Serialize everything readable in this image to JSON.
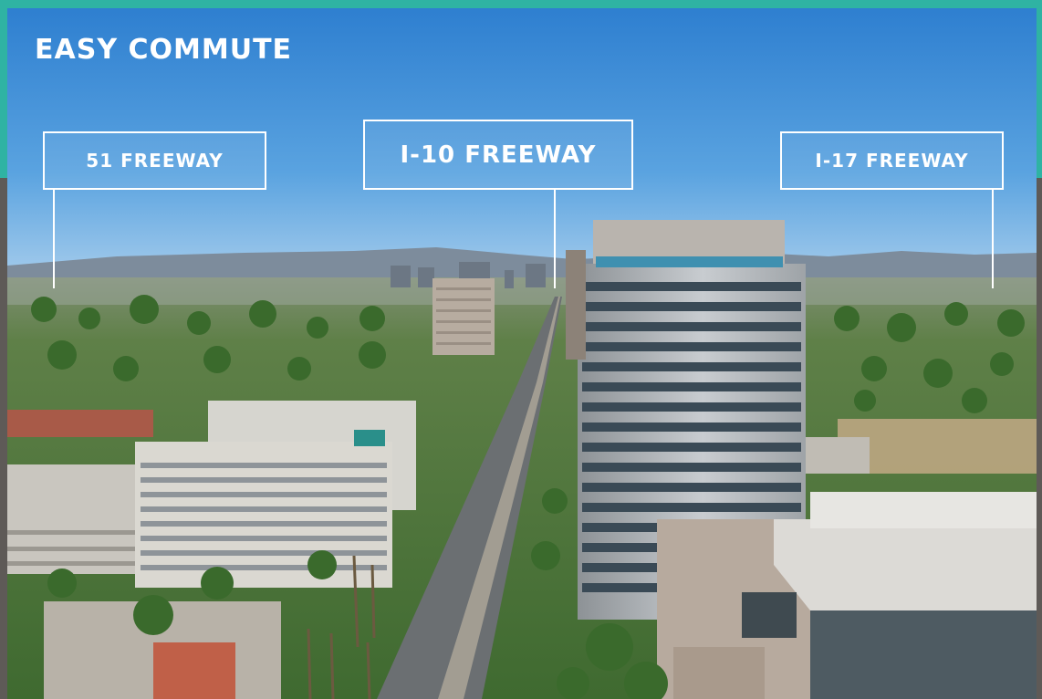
{
  "heading": "EASY COMMUTE",
  "callouts": {
    "freeway_51": "51 FREEWAY",
    "freeway_i10": "I-10 FREEWAY",
    "freeway_i17": "I-17 FREEWAY"
  },
  "colors": {
    "accent_teal": "#2fb3a3",
    "frame_grey": "#5e5a57",
    "sky_top": "#2e7fd0",
    "sky_horizon": "#a7cdec",
    "label_text": "#ffffff"
  }
}
